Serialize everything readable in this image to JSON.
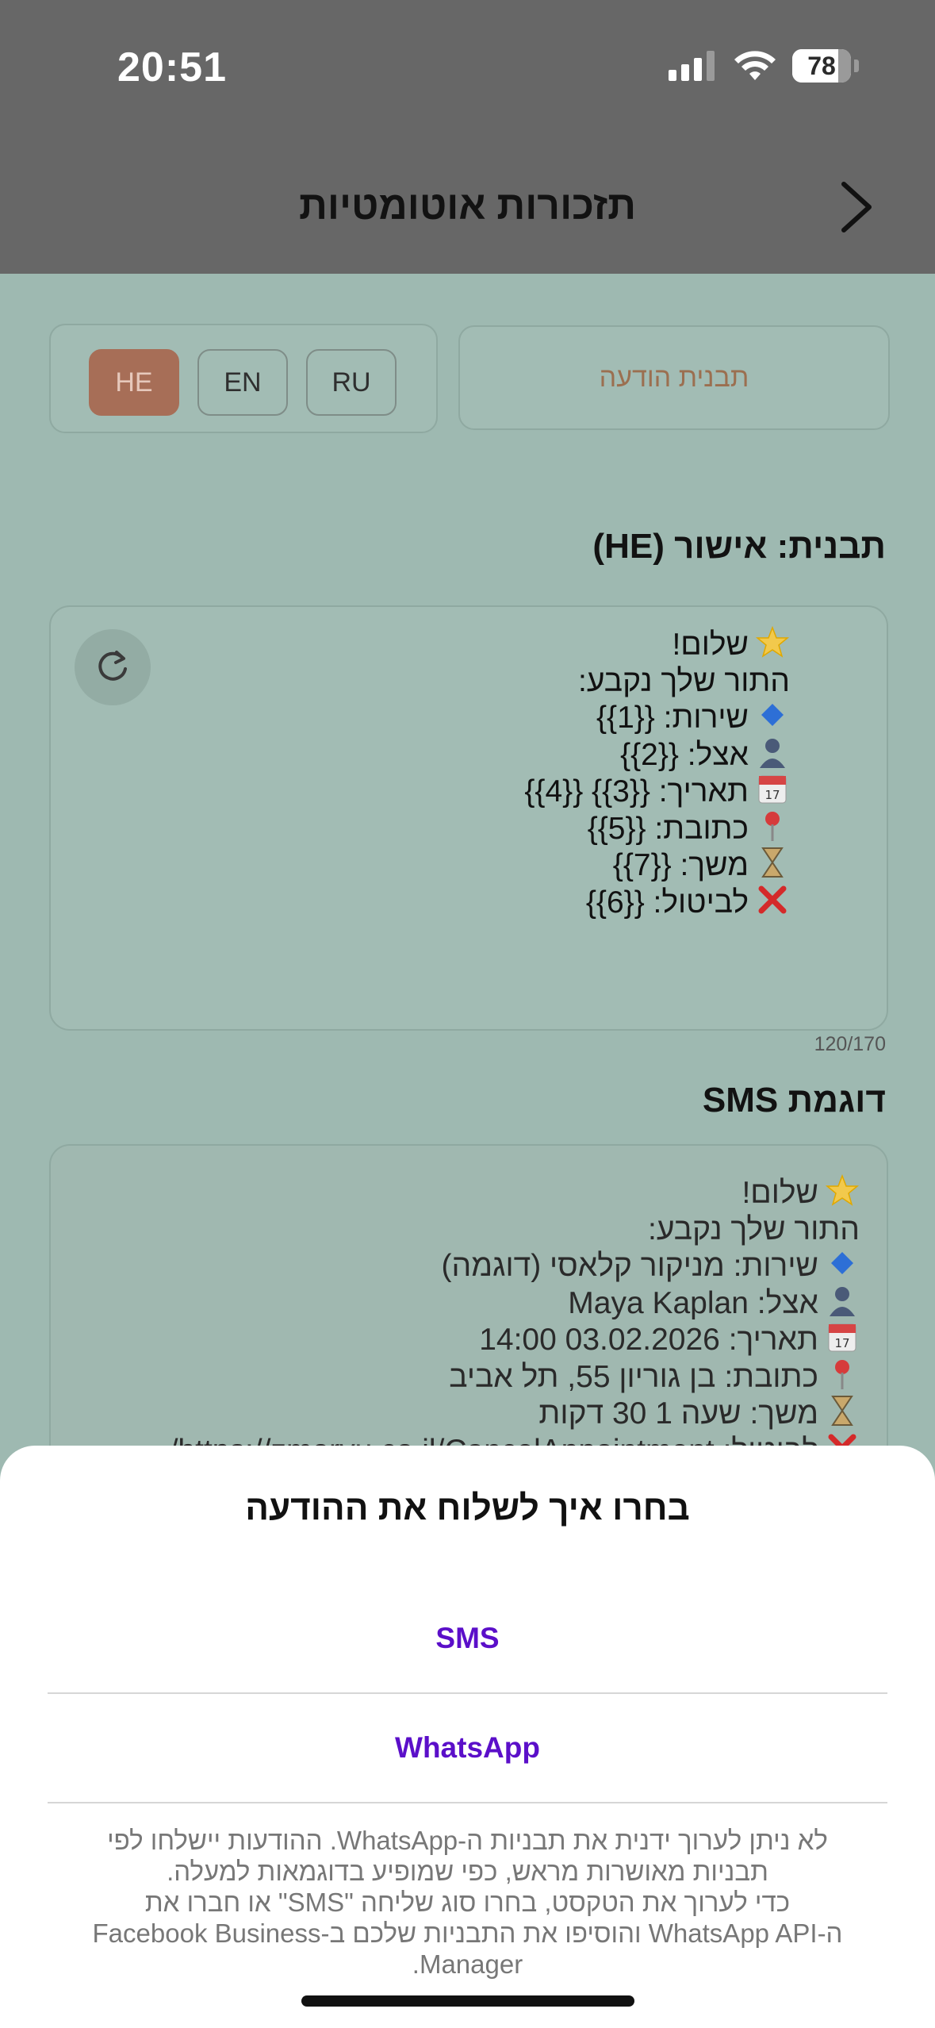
{
  "status_bar": {
    "time": "20:51",
    "battery": "78",
    "battery_level": 0.78,
    "icons": [
      "signal-icon",
      "wifi-icon",
      "battery-icon"
    ]
  },
  "header": {
    "title": "תזכורות אוטומטיות",
    "back_icon": "chevron-right-icon"
  },
  "controls": {
    "template_button": "תבנית הודעה",
    "languages": [
      {
        "label": "HE",
        "active": true
      },
      {
        "label": "EN",
        "active": false
      },
      {
        "label": "RU",
        "active": false
      }
    ]
  },
  "editor": {
    "section_title": "תבנית: אישור (HE)",
    "lines": [
      {
        "emoji": "star-icon",
        "text": "שלום!"
      },
      {
        "emoji": "",
        "text": "התור שלך נקבע:"
      },
      {
        "emoji": "diamond-icon",
        "text": "שירות: {{1}}"
      },
      {
        "emoji": "person-icon",
        "text": "אצל: {{2}}"
      },
      {
        "emoji": "calendar-icon",
        "text": "תאריך: {{3}} {{4}}"
      },
      {
        "emoji": "pin-icon",
        "text": "כתובת: {{5}}"
      },
      {
        "emoji": "hourglass-icon",
        "text": "משך: {{7}}"
      },
      {
        "emoji": "cross-icon",
        "text": "לביטול: {{6}}"
      }
    ],
    "refresh_icon": "refresh-icon",
    "counter": "120/170"
  },
  "sample": {
    "section_title": "דוגמת SMS",
    "lines": [
      {
        "emoji": "star-icon",
        "text": "שלום!"
      },
      {
        "emoji": "",
        "text": "התור שלך נקבע:"
      },
      {
        "emoji": "diamond-icon",
        "text": "שירות: מניקור קלאסי (דוגמה)"
      },
      {
        "emoji": "person-icon",
        "text": "אצל: Maya Kaplan"
      },
      {
        "emoji": "calendar-icon",
        "text": "תאריך: 03.02.2026 14:00"
      },
      {
        "emoji": "pin-icon",
        "text": "כתובת: בן גוריון 55, תל אביב"
      },
      {
        "emoji": "hourglass-icon",
        "text": "משך: שעה 1 30 דקות"
      },
      {
        "emoji": "cross-icon",
        "text": "לביטול: https://zmoryu.co.il/CancelAppointment/"
      }
    ]
  },
  "sheet": {
    "title": "בחרו איך לשלוח את ההודעה",
    "options": [
      "SMS",
      "WhatsApp"
    ],
    "note_lines": [
      "לא ניתן לערוך ידנית את תבניות ה-WhatsApp. ההודעות יישלחו לפי",
      "תבניות מאושרות מראש, כפי שמופיע בדוגמאות למעלה.",
      "כדי לערוך את הטקסט, בחרו סוג שליחה \"SMS\" או חברו את",
      "ה-WhatsApp API והוסיפו את התבניות שלכם ב-Facebook Business",
      "Manager."
    ]
  },
  "colors": {
    "accent": "#5b0fc9",
    "active_lang": "#a76e57",
    "overlay_bg": "#9eb9b1"
  }
}
